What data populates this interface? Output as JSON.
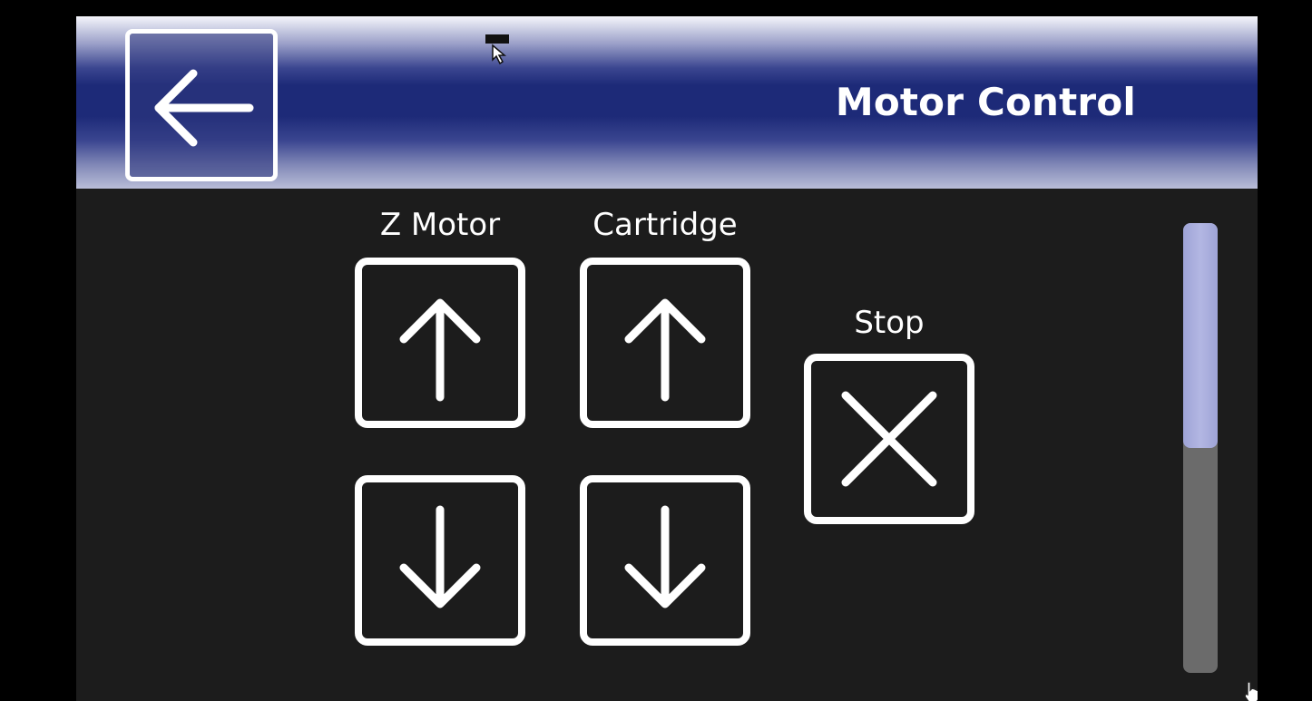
{
  "header": {
    "title": "Motor Control",
    "back_icon": "arrow-left-icon",
    "gradient_colors": [
      "#f4f5fb",
      "#1d2a78",
      "#b9bdd8"
    ]
  },
  "controls": {
    "z_motor": {
      "label": "Z Motor",
      "up_icon": "arrow-up-icon",
      "down_icon": "arrow-down-icon"
    },
    "cartridge": {
      "label": "Cartridge",
      "up_icon": "arrow-up-icon",
      "down_icon": "arrow-down-icon"
    },
    "stop": {
      "label": "Stop",
      "icon": "close-x-icon"
    }
  },
  "scrollbar": {
    "thumb_fraction": 0.5,
    "scroll_position": 0,
    "thumb_color": "#b3b7e3",
    "track_color": "#6b6b6b"
  },
  "colors": {
    "background": "#1c1c1c",
    "outer_background": "#000000",
    "button_stroke": "#ffffff"
  }
}
